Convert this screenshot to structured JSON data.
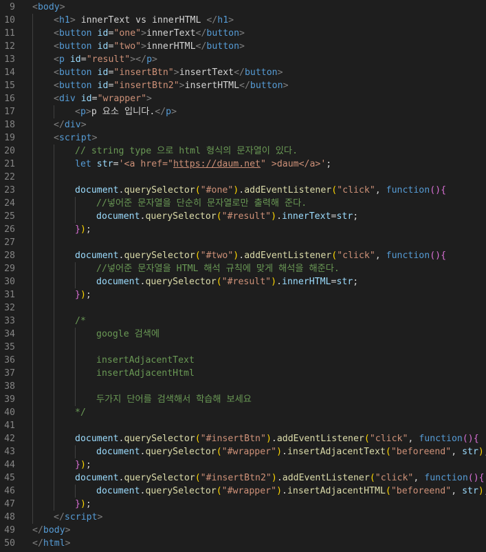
{
  "editor": {
    "lines": [
      {
        "n": "9",
        "indent": 0,
        "tokens": [
          [
            "t-punct",
            "<"
          ],
          [
            "t-tag",
            "body"
          ],
          [
            "t-punct",
            ">"
          ]
        ]
      },
      {
        "n": "10",
        "indent": 1,
        "tokens": [
          [
            "t-punct",
            "<"
          ],
          [
            "t-tag",
            "h1"
          ],
          [
            "t-punct",
            ">"
          ],
          [
            "t-text",
            " innerText vs innerHTML "
          ],
          [
            "t-punct",
            "</"
          ],
          [
            "t-tag",
            "h1"
          ],
          [
            "t-punct",
            ">"
          ]
        ]
      },
      {
        "n": "11",
        "indent": 1,
        "tokens": [
          [
            "t-punct",
            "<"
          ],
          [
            "t-tag",
            "button"
          ],
          [
            "t-text",
            " "
          ],
          [
            "t-attr",
            "id"
          ],
          [
            "t-text",
            "="
          ],
          [
            "t-str",
            "\"one\""
          ],
          [
            "t-punct",
            ">"
          ],
          [
            "t-text",
            "innerText"
          ],
          [
            "t-punct",
            "</"
          ],
          [
            "t-tag",
            "button"
          ],
          [
            "t-punct",
            ">"
          ]
        ]
      },
      {
        "n": "12",
        "indent": 1,
        "tokens": [
          [
            "t-punct",
            "<"
          ],
          [
            "t-tag",
            "button"
          ],
          [
            "t-text",
            " "
          ],
          [
            "t-attr",
            "id"
          ],
          [
            "t-text",
            "="
          ],
          [
            "t-str",
            "\"two\""
          ],
          [
            "t-punct",
            ">"
          ],
          [
            "t-text",
            "innerHTML"
          ],
          [
            "t-punct",
            "</"
          ],
          [
            "t-tag",
            "button"
          ],
          [
            "t-punct",
            ">"
          ]
        ]
      },
      {
        "n": "13",
        "indent": 1,
        "tokens": [
          [
            "t-punct",
            "<"
          ],
          [
            "t-tag",
            "p"
          ],
          [
            "t-text",
            " "
          ],
          [
            "t-attr",
            "id"
          ],
          [
            "t-text",
            "="
          ],
          [
            "t-str",
            "\"result\""
          ],
          [
            "t-punct",
            "></"
          ],
          [
            "t-tag",
            "p"
          ],
          [
            "t-punct",
            ">"
          ]
        ]
      },
      {
        "n": "14",
        "indent": 1,
        "tokens": [
          [
            "t-punct",
            "<"
          ],
          [
            "t-tag",
            "button"
          ],
          [
            "t-text",
            " "
          ],
          [
            "t-attr",
            "id"
          ],
          [
            "t-text",
            "="
          ],
          [
            "t-str",
            "\"insertBtn\""
          ],
          [
            "t-punct",
            ">"
          ],
          [
            "t-text",
            "insertText"
          ],
          [
            "t-punct",
            "</"
          ],
          [
            "t-tag",
            "button"
          ],
          [
            "t-punct",
            ">"
          ]
        ]
      },
      {
        "n": "15",
        "indent": 1,
        "tokens": [
          [
            "t-punct",
            "<"
          ],
          [
            "t-tag",
            "button"
          ],
          [
            "t-text",
            " "
          ],
          [
            "t-attr",
            "id"
          ],
          [
            "t-text",
            "="
          ],
          [
            "t-str",
            "\"insertBtn2\""
          ],
          [
            "t-punct",
            ">"
          ],
          [
            "t-text",
            "insertHTML"
          ],
          [
            "t-punct",
            "</"
          ],
          [
            "t-tag",
            "button"
          ],
          [
            "t-punct",
            ">"
          ]
        ]
      },
      {
        "n": "16",
        "indent": 1,
        "tokens": [
          [
            "t-punct",
            "<"
          ],
          [
            "t-tag",
            "div"
          ],
          [
            "t-text",
            " "
          ],
          [
            "t-attr",
            "id"
          ],
          [
            "t-text",
            "="
          ],
          [
            "t-str",
            "\"wrapper\""
          ],
          [
            "t-punct",
            ">"
          ]
        ]
      },
      {
        "n": "17",
        "indent": 2,
        "tokens": [
          [
            "t-punct",
            "<"
          ],
          [
            "t-tag",
            "p"
          ],
          [
            "t-punct",
            ">"
          ],
          [
            "t-text",
            "p 요소 입니다."
          ],
          [
            "t-punct",
            "</"
          ],
          [
            "t-tag",
            "p"
          ],
          [
            "t-punct",
            ">"
          ]
        ]
      },
      {
        "n": "18",
        "indent": 1,
        "tokens": [
          [
            "t-punct",
            "</"
          ],
          [
            "t-tag",
            "div"
          ],
          [
            "t-punct",
            ">"
          ]
        ]
      },
      {
        "n": "19",
        "indent": 1,
        "tokens": [
          [
            "t-punct",
            "<"
          ],
          [
            "t-tag",
            "script"
          ],
          [
            "t-punct",
            ">"
          ]
        ]
      },
      {
        "n": "20",
        "indent": 2,
        "tokens": [
          [
            "t-comment",
            "// string type 으로 html 형식의 문자열이 있다."
          ]
        ]
      },
      {
        "n": "21",
        "indent": 2,
        "tokens": [
          [
            "t-kw",
            "let"
          ],
          [
            "t-text",
            " "
          ],
          [
            "t-var",
            "str"
          ],
          [
            "t-text",
            "="
          ],
          [
            "t-str",
            "'<a href=\""
          ],
          [
            "t-url",
            "https://daum.net"
          ],
          [
            "t-str",
            "\" >daum</a>'"
          ],
          [
            "t-text",
            ";"
          ]
        ]
      },
      {
        "n": "22",
        "indent": 0,
        "tokens": []
      },
      {
        "n": "23",
        "indent": 2,
        "tokens": [
          [
            "t-var",
            "document"
          ],
          [
            "t-text",
            "."
          ],
          [
            "t-fn",
            "querySelector"
          ],
          [
            "t-brace2",
            "("
          ],
          [
            "t-str",
            "\"#one\""
          ],
          [
            "t-brace2",
            ")"
          ],
          [
            "t-text",
            "."
          ],
          [
            "t-fn",
            "addEventListener"
          ],
          [
            "t-brace2",
            "("
          ],
          [
            "t-str",
            "\"click\""
          ],
          [
            "t-text",
            ", "
          ],
          [
            "t-kw",
            "function"
          ],
          [
            "t-brace",
            "()"
          ],
          [
            "t-brace",
            "{"
          ]
        ]
      },
      {
        "n": "24",
        "indent": 3,
        "tokens": [
          [
            "t-comment",
            "//넣어준 문자열을 단순히 문자열로만 출력해 준다."
          ]
        ]
      },
      {
        "n": "25",
        "indent": 3,
        "tokens": [
          [
            "t-var",
            "document"
          ],
          [
            "t-text",
            "."
          ],
          [
            "t-fn",
            "querySelector"
          ],
          [
            "t-brace2",
            "("
          ],
          [
            "t-str",
            "\"#result\""
          ],
          [
            "t-brace2",
            ")"
          ],
          [
            "t-text",
            "."
          ],
          [
            "t-var",
            "innerText"
          ],
          [
            "t-text",
            "="
          ],
          [
            "t-var",
            "str"
          ],
          [
            "t-text",
            ";"
          ]
        ]
      },
      {
        "n": "26",
        "indent": 2,
        "tokens": [
          [
            "t-brace",
            "}"
          ],
          [
            "t-brace2",
            ")"
          ],
          [
            "t-text",
            ";"
          ]
        ]
      },
      {
        "n": "27",
        "indent": 0,
        "tokens": []
      },
      {
        "n": "28",
        "indent": 2,
        "tokens": [
          [
            "t-var",
            "document"
          ],
          [
            "t-text",
            "."
          ],
          [
            "t-fn",
            "querySelector"
          ],
          [
            "t-brace2",
            "("
          ],
          [
            "t-str",
            "\"#two\""
          ],
          [
            "t-brace2",
            ")"
          ],
          [
            "t-text",
            "."
          ],
          [
            "t-fn",
            "addEventListener"
          ],
          [
            "t-brace2",
            "("
          ],
          [
            "t-str",
            "\"click\""
          ],
          [
            "t-text",
            ", "
          ],
          [
            "t-kw",
            "function"
          ],
          [
            "t-brace",
            "()"
          ],
          [
            "t-brace",
            "{"
          ]
        ]
      },
      {
        "n": "29",
        "indent": 3,
        "tokens": [
          [
            "t-comment",
            "//넣어준 문자열을 HTML 해석 규칙에 맞게 해석을 해준다."
          ]
        ]
      },
      {
        "n": "30",
        "indent": 3,
        "tokens": [
          [
            "t-var",
            "document"
          ],
          [
            "t-text",
            "."
          ],
          [
            "t-fn",
            "querySelector"
          ],
          [
            "t-brace2",
            "("
          ],
          [
            "t-str",
            "\"#result\""
          ],
          [
            "t-brace2",
            ")"
          ],
          [
            "t-text",
            "."
          ],
          [
            "t-var",
            "innerHTML"
          ],
          [
            "t-text",
            "="
          ],
          [
            "t-var",
            "str"
          ],
          [
            "t-text",
            ";"
          ]
        ]
      },
      {
        "n": "31",
        "indent": 2,
        "tokens": [
          [
            "t-brace",
            "}"
          ],
          [
            "t-brace2",
            ")"
          ],
          [
            "t-text",
            ";"
          ]
        ]
      },
      {
        "n": "32",
        "indent": 0,
        "tokens": []
      },
      {
        "n": "33",
        "indent": 2,
        "tokens": [
          [
            "t-comment",
            "/*"
          ]
        ]
      },
      {
        "n": "34",
        "indent": 3,
        "tokens": [
          [
            "t-comment",
            "google 검색에"
          ]
        ]
      },
      {
        "n": "35",
        "indent": 0,
        "tokens": []
      },
      {
        "n": "36",
        "indent": 3,
        "tokens": [
          [
            "t-comment",
            "insertAdjacentText"
          ]
        ]
      },
      {
        "n": "37",
        "indent": 3,
        "tokens": [
          [
            "t-comment",
            "insertAdjacentHtml"
          ]
        ]
      },
      {
        "n": "38",
        "indent": 0,
        "tokens": []
      },
      {
        "n": "39",
        "indent": 3,
        "tokens": [
          [
            "t-comment",
            "두가지 단어를 검색해서 학습해 보세요"
          ]
        ]
      },
      {
        "n": "40",
        "indent": 2,
        "tokens": [
          [
            "t-comment",
            "*/"
          ]
        ]
      },
      {
        "n": "41",
        "indent": 0,
        "tokens": []
      },
      {
        "n": "42",
        "indent": 2,
        "tokens": [
          [
            "t-var",
            "document"
          ],
          [
            "t-text",
            "."
          ],
          [
            "t-fn",
            "querySelector"
          ],
          [
            "t-brace2",
            "("
          ],
          [
            "t-str",
            "\"#insertBtn\""
          ],
          [
            "t-brace2",
            ")"
          ],
          [
            "t-text",
            "."
          ],
          [
            "t-fn",
            "addEventListener"
          ],
          [
            "t-brace2",
            "("
          ],
          [
            "t-str",
            "\"click\""
          ],
          [
            "t-text",
            ", "
          ],
          [
            "t-kw",
            "function"
          ],
          [
            "t-brace",
            "()"
          ],
          [
            "t-brace",
            "{"
          ]
        ]
      },
      {
        "n": "43",
        "indent": 3,
        "tokens": [
          [
            "t-var",
            "document"
          ],
          [
            "t-text",
            "."
          ],
          [
            "t-fn",
            "querySelector"
          ],
          [
            "t-brace2",
            "("
          ],
          [
            "t-str",
            "\"#wrapper\""
          ],
          [
            "t-brace2",
            ")"
          ],
          [
            "t-text",
            "."
          ],
          [
            "t-fn",
            "insertAdjacentText"
          ],
          [
            "t-brace2",
            "("
          ],
          [
            "t-str",
            "\"beforeend\""
          ],
          [
            "t-text",
            ", "
          ],
          [
            "t-var",
            "str"
          ],
          [
            "t-brace2",
            ")"
          ],
          [
            "t-text",
            ";"
          ]
        ]
      },
      {
        "n": "44",
        "indent": 2,
        "tokens": [
          [
            "t-brace",
            "}"
          ],
          [
            "t-brace2",
            ")"
          ],
          [
            "t-text",
            ";"
          ]
        ]
      },
      {
        "n": "45",
        "indent": 2,
        "tokens": [
          [
            "t-var",
            "document"
          ],
          [
            "t-text",
            "."
          ],
          [
            "t-fn",
            "querySelector"
          ],
          [
            "t-brace2",
            "("
          ],
          [
            "t-str",
            "\"#insertBtn2\""
          ],
          [
            "t-brace2",
            ")"
          ],
          [
            "t-text",
            "."
          ],
          [
            "t-fn",
            "addEventListener"
          ],
          [
            "t-brace2",
            "("
          ],
          [
            "t-str",
            "\"click\""
          ],
          [
            "t-text",
            ", "
          ],
          [
            "t-kw",
            "function"
          ],
          [
            "t-brace",
            "()"
          ],
          [
            "t-brace",
            "{"
          ]
        ]
      },
      {
        "n": "46",
        "indent": 3,
        "tokens": [
          [
            "t-var",
            "document"
          ],
          [
            "t-text",
            "."
          ],
          [
            "t-fn",
            "querySelector"
          ],
          [
            "t-brace2",
            "("
          ],
          [
            "t-str",
            "\"#wrapper\""
          ],
          [
            "t-brace2",
            ")"
          ],
          [
            "t-text",
            "."
          ],
          [
            "t-fn",
            "insertAdjacentHTML"
          ],
          [
            "t-brace2",
            "("
          ],
          [
            "t-str",
            "\"beforeend\""
          ],
          [
            "t-text",
            ", "
          ],
          [
            "t-var",
            "str"
          ],
          [
            "t-brace2",
            ")"
          ],
          [
            "t-text",
            ";"
          ]
        ]
      },
      {
        "n": "47",
        "indent": 2,
        "tokens": [
          [
            "t-brace",
            "}"
          ],
          [
            "t-brace2",
            ")"
          ],
          [
            "t-text",
            ";"
          ]
        ]
      },
      {
        "n": "48",
        "indent": 1,
        "tokens": [
          [
            "t-punct",
            "</"
          ],
          [
            "t-tag",
            "script"
          ],
          [
            "t-punct",
            ">"
          ]
        ]
      },
      {
        "n": "49",
        "indent": 0,
        "tokens": [
          [
            "t-punct",
            "</"
          ],
          [
            "t-tag",
            "body"
          ],
          [
            "t-punct",
            ">"
          ]
        ]
      },
      {
        "n": "50",
        "indent": 0,
        "tokens": [
          [
            "t-punct",
            "</"
          ],
          [
            "t-tag",
            "html"
          ],
          [
            "t-punct",
            ">"
          ]
        ]
      }
    ]
  }
}
